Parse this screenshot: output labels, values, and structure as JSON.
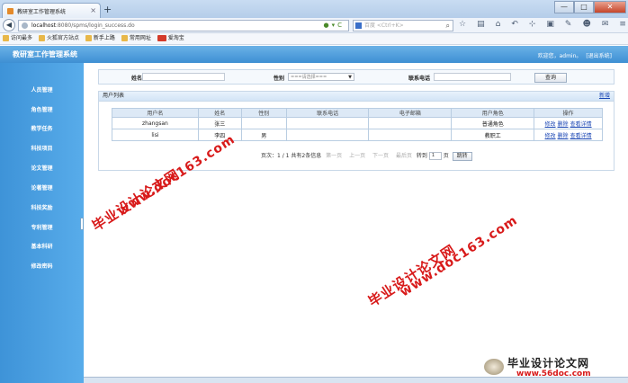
{
  "browser": {
    "tab_title": "教研室工作管理系统",
    "tab_close": "×",
    "new_tab": "+",
    "url_host": "localhost",
    "url_rest": ":8080/spms/login_success.do",
    "search_placeholder": "百度 <Ctrl+K>",
    "window_buttons": {
      "minimize": "—",
      "maximize": "□",
      "close": "✕"
    },
    "bookmarks": [
      "访问最多",
      "火狐官方站点",
      "新手上路",
      "常用网址",
      "爱淘宝"
    ]
  },
  "app": {
    "title": "教研室工作管理系统",
    "welcome": "欢迎您，admin。",
    "logout": "[退出系统]"
  },
  "sidebar": {
    "items": [
      {
        "label": "人员管理"
      },
      {
        "label": "角色管理"
      },
      {
        "label": "教学任务"
      },
      {
        "label": "科技项目"
      },
      {
        "label": "论文管理"
      },
      {
        "label": "论著管理"
      },
      {
        "label": "科技奖励"
      },
      {
        "label": "专利管理"
      },
      {
        "label": "基本科研"
      },
      {
        "label": "修改密码"
      }
    ]
  },
  "search": {
    "name_label": "姓名",
    "gender_label": "性别",
    "gender_value": "===请选择===",
    "phone_label": "联系电话",
    "query_button": "查询"
  },
  "list": {
    "title": "用户列表",
    "add": "新增",
    "columns": [
      "用户名",
      "姓名",
      "性别",
      "联系电话",
      "电子邮箱",
      "用户角色",
      "操作"
    ],
    "rows": [
      {
        "username": "zhangsan",
        "name": "张三",
        "gender": "",
        "phone": "",
        "email": "",
        "role": "普通角色"
      },
      {
        "username": "lisi",
        "name": "李四",
        "gender": "男",
        "phone": "",
        "email": "",
        "role": "教职工"
      }
    ],
    "actions": {
      "edit": "修改",
      "delete": "删除",
      "view": "查看详情"
    }
  },
  "pager": {
    "info": "页次：1 / 1 共有2条信息",
    "first": "第一页",
    "prev": "上一页",
    "next": "下一页",
    "last": "最后页",
    "goto": "转到",
    "page_value": "1",
    "page_unit": "页",
    "jump": "跳转"
  },
  "watermarks": {
    "cn": "毕业设计论文网",
    "url": "www.doc163.com",
    "logo_cn": "毕业设计论文网",
    "logo_url": "www.56doc.com"
  }
}
